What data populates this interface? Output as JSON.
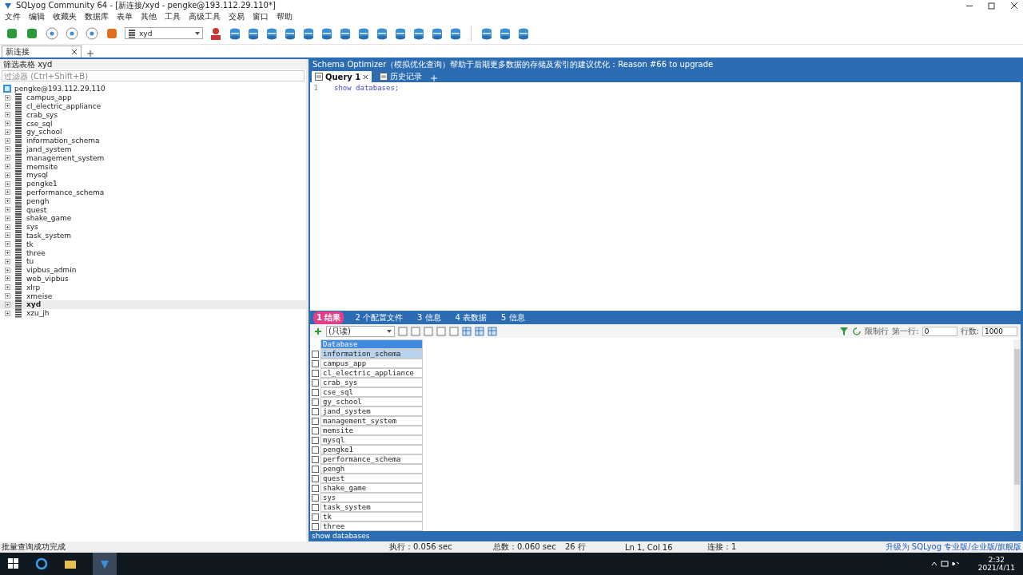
{
  "window": {
    "title": "SQLyog Community 64 - [新连接/xyd - pengke@193.112.29.110*]"
  },
  "menu": [
    "文件",
    "编辑",
    "收藏夹",
    "数据库",
    "表单",
    "其他",
    "工具",
    "高级工具",
    "交易",
    "窗口",
    "帮助"
  ],
  "toolbar": {
    "database_select": "xyd"
  },
  "connection_tabs": [
    {
      "label": "新连接",
      "selected": true
    }
  ],
  "object_browser": {
    "title": "筛选表格 xyd",
    "filter_placeholder": "过滤器 (Ctrl+Shift+B)",
    "tree": [
      {
        "label": "pengke@193.112.29.110",
        "children": [
          {
            "label": "campus_app",
            "selected": false
          },
          {
            "label": "cl_electric_appliance",
            "selected": false
          },
          {
            "label": "crab_sys",
            "selected": false
          },
          {
            "label": "cse_sql",
            "selected": false
          },
          {
            "label": "gy_school",
            "selected": false
          },
          {
            "label": "information_schema",
            "selected": false
          },
          {
            "label": "jand_system",
            "selected": false
          },
          {
            "label": "management_system",
            "selected": false
          },
          {
            "label": "memsite",
            "selected": false
          },
          {
            "label": "mysql",
            "selected": false
          },
          {
            "label": "pengke1",
            "selected": false
          },
          {
            "label": "performance_schema",
            "selected": false
          },
          {
            "label": "pengh",
            "selected": false
          },
          {
            "label": "quest",
            "selected": false
          },
          {
            "label": "shake_game",
            "selected": false
          },
          {
            "label": "sys",
            "selected": false
          },
          {
            "label": "task_system",
            "selected": false
          },
          {
            "label": "tk",
            "selected": false
          },
          {
            "label": "three",
            "selected": false
          },
          {
            "label": "tu",
            "selected": false
          },
          {
            "label": "vipbus_admin",
            "selected": false
          },
          {
            "label": "web_vipbus",
            "selected": false
          },
          {
            "label": "xlrp",
            "selected": false
          },
          {
            "label": "xmeise",
            "selected": false
          },
          {
            "label": "xyd",
            "selected": true
          },
          {
            "label": "xzu_jh",
            "selected": false
          }
        ]
      }
    ]
  },
  "banner": "Schema Optimizer（模拟优化查询）帮助于后期更多数据的存储及索引的建议优化：Reason #66 to upgrade",
  "query_tabs": [
    {
      "label": "Query 1",
      "selected": true,
      "closable": true
    },
    {
      "label": "历史记录",
      "selected": false,
      "closable": false
    }
  ],
  "editor": {
    "lines": [
      {
        "number": "1",
        "code": "show databases;"
      }
    ]
  },
  "result_tabs": [
    {
      "label": "1 结果",
      "selected": true
    },
    {
      "label": "2 个配置文件",
      "selected": false
    },
    {
      "label": "3 信息",
      "selected": false
    },
    {
      "label": "4 表数据",
      "selected": false
    },
    {
      "label": "5 信息",
      "selected": false
    }
  ],
  "result_toolbar": {
    "mode": "(只读)",
    "limit_label": "限制行",
    "first_row_label": "第一行:",
    "first_row": "0",
    "rows_label": "行数:",
    "rows": "1000"
  },
  "result_grid": {
    "columns": [
      "Database"
    ],
    "rows": [
      {
        "value": "information_schema",
        "selected": true,
        "checked": false
      },
      {
        "value": "campus_app",
        "selected": false,
        "checked": false
      },
      {
        "value": "cl_electric_appliance",
        "selected": false,
        "checked": false
      },
      {
        "value": "crab_sys",
        "selected": false,
        "checked": false
      },
      {
        "value": "cse_sql",
        "selected": false,
        "checked": false
      },
      {
        "value": "gy_school",
        "selected": false,
        "checked": false
      },
      {
        "value": "jand_system",
        "selected": false,
        "checked": false
      },
      {
        "value": "management_system",
        "selected": false,
        "checked": false
      },
      {
        "value": "memsite",
        "selected": false,
        "checked": false
      },
      {
        "value": "mysql",
        "selected": false,
        "checked": false
      },
      {
        "value": "pengke1",
        "selected": false,
        "checked": false
      },
      {
        "value": "performance_schema",
        "selected": false,
        "checked": false
      },
      {
        "value": "pengh",
        "selected": false,
        "checked": false
      },
      {
        "value": "quest",
        "selected": false,
        "checked": false
      },
      {
        "value": "shake_game",
        "selected": false,
        "checked": false
      },
      {
        "value": "sys",
        "selected": false,
        "checked": false
      },
      {
        "value": "task_system",
        "selected": false,
        "checked": false
      },
      {
        "value": "tk",
        "selected": false,
        "checked": false
      },
      {
        "value": "three",
        "selected": false,
        "checked": false
      }
    ]
  },
  "query_status": "show databases",
  "status_bar": [
    "批量查询成功完成",
    "执行：0.056 sec",
    "总数：0.060 sec",
    "26 行",
    "Ln 1, Col 16",
    "连接：1",
    "升级为 SQLyog 专业版/企业版/旗舰版"
  ],
  "taskbar": {
    "time": "2:32",
    "date": "2021/4/11"
  }
}
